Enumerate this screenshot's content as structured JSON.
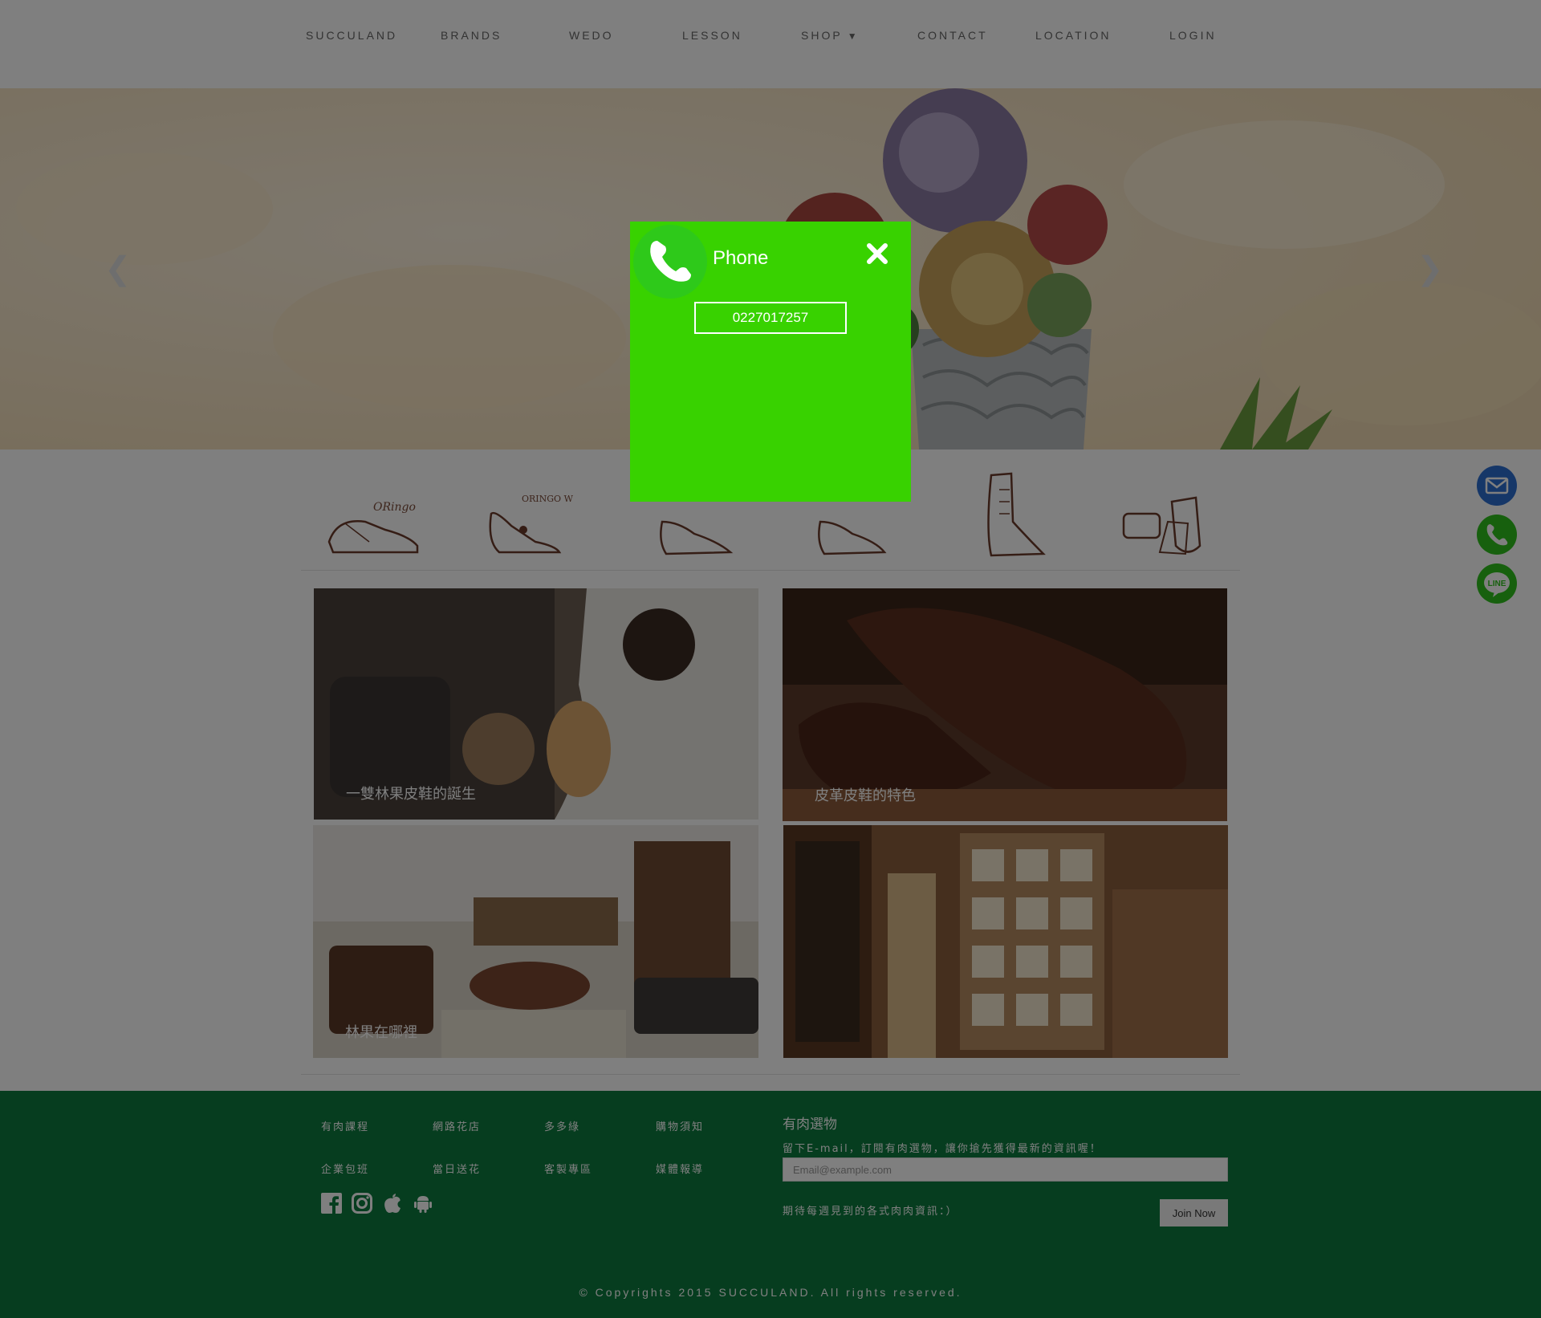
{
  "nav": {
    "items": [
      {
        "label": "SUCCULAND"
      },
      {
        "label": "BRANDS"
      },
      {
        "label": "WEDO"
      },
      {
        "label": "LESSON"
      },
      {
        "label": "SHOP"
      },
      {
        "label": "CONTACT"
      },
      {
        "label": "LOCATION"
      },
      {
        "label": "LOGIN"
      }
    ],
    "shop_chevron_icon": "chevron-down-icon"
  },
  "hero": {
    "prev_icon": "chevron-left-icon",
    "next_icon": "chevron-right-icon"
  },
  "brands": {
    "logo_text_1": "ORingo",
    "logo_text_2": "ORINGO W"
  },
  "tiles": [
    {
      "label": "一雙林果皮鞋的誕生"
    },
    {
      "label": "皮革皮鞋的特色"
    },
    {
      "label": "林果在哪裡"
    },
    {
      "label": ""
    }
  ],
  "footer": {
    "links": [
      {
        "label": "有肉課程"
      },
      {
        "label": "網路花店"
      },
      {
        "label": "多多綠"
      },
      {
        "label": "購物須知"
      },
      {
        "label": "企業包班"
      },
      {
        "label": "當日送花"
      },
      {
        "label": "客製專區"
      },
      {
        "label": "媒體報導"
      }
    ],
    "social_icons": [
      "facebook-icon",
      "instagram-icon",
      "apple-icon",
      "android-icon"
    ],
    "newsletter_heading": "有肉選物",
    "newsletter_sub": "留下E-mail，訂閱有肉選物，讓你搶先獲得最新的資訊喔！",
    "email_placeholder": "Email@example.com",
    "note": "期待每週見到的各式肉肉資訊：）",
    "join_label": "Join Now",
    "copyright": "© Copyrights 2015 SUCCULAND. All rights reserved."
  },
  "side_buttons": [
    {
      "icon": "mail-icon",
      "color": "#2d6fd1"
    },
    {
      "icon": "phone-icon",
      "color": "#2fc01c"
    },
    {
      "icon": "line-icon",
      "label": "LINE",
      "color": "#2fc01c"
    }
  ],
  "modal": {
    "title": "Phone",
    "number": "0227017257",
    "icon": "phone-icon",
    "close_icon": "close-icon",
    "color": "#38d200"
  },
  "colors": {
    "footer": "#0d7a3f",
    "overlay": "rgba(0,0,0,0.5)"
  }
}
